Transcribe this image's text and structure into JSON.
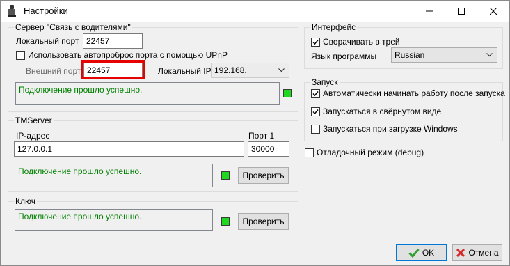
{
  "window": {
    "title": "Настройки"
  },
  "server_group": {
    "title": "Сервер \"Связь с водителями\"",
    "local_port_label": "Локальный порт",
    "local_port_value": "22457",
    "upnp_label": "Использовать автопроброс порта с помощью UPnP",
    "upnp_checked": false,
    "external_port_label": "Внешний порт",
    "external_port_value": "22457",
    "local_ip_label": "Локальный IP",
    "local_ip_value": "192.168.",
    "status_text": "Подключение прошло успешно."
  },
  "tmserver_group": {
    "title": "TMServer",
    "ip_label": "IP-адрес",
    "ip_value": "127.0.0.1",
    "port_label": "Порт 1",
    "port_value": "30000",
    "status_text": "Подключение прошло успешно.",
    "check_button": "Проверить"
  },
  "key_group": {
    "title": "Ключ",
    "status_text": "Подключение прошло успешно.",
    "check_button": "Проверить"
  },
  "interface_group": {
    "title": "Интерфейс",
    "minimize_tray_label": "Сворачивать в трей",
    "minimize_tray_checked": true,
    "language_label": "Язык программы",
    "language_value": "Russian"
  },
  "startup_group": {
    "title": "Запуск",
    "auto_start_label": "Автоматически начинать работу после запуска",
    "auto_start_checked": true,
    "start_minimized_label": "Запускаться в свёрнутом виде",
    "start_minimized_checked": true,
    "start_with_windows_label": "Запускаться при загрузке Windows",
    "start_with_windows_checked": false
  },
  "debug": {
    "label": "Отладочный режим (debug)",
    "checked": false
  },
  "footer": {
    "ok_label": "OK",
    "cancel_label": "Отмена"
  },
  "colors": {
    "status_text": "#008000",
    "led": "#1fd81f",
    "highlight": "#e60000",
    "focus_border": "#0078d7"
  },
  "icons": [
    "app-icon",
    "minimize-icon",
    "maximize-icon",
    "close-icon",
    "dropdown-arrow-icon",
    "checkmark-icon",
    "ok-check-icon",
    "cancel-x-icon"
  ]
}
